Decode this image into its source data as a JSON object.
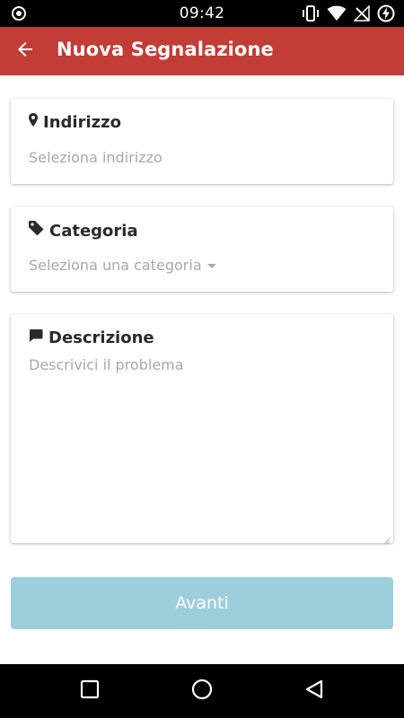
{
  "status_bar": {
    "time": "09:42",
    "icons": [
      "sync-circle-icon",
      "vibrate-icon",
      "wifi-icon",
      "no-signal-icon",
      "battery-charging-icon"
    ]
  },
  "app_bar": {
    "title": "Nuova Segnalazione",
    "back_icon": "arrow-left-icon",
    "color": "#c23d35"
  },
  "form": {
    "address": {
      "label": "Indirizzo",
      "icon": "map-pin-icon",
      "placeholder": "Seleziona indirizzo"
    },
    "category": {
      "label": "Categoria",
      "icon": "tag-icon",
      "placeholder": "Seleziona una categoria"
    },
    "description": {
      "label": "Descrizione",
      "icon": "comment-icon",
      "placeholder": "Descrivici il problema"
    }
  },
  "next_button": {
    "label": "Avanti",
    "color": "#9ccfdb"
  },
  "nav_bar": {
    "icons": [
      "recents-icon",
      "home-icon",
      "back-icon"
    ]
  }
}
